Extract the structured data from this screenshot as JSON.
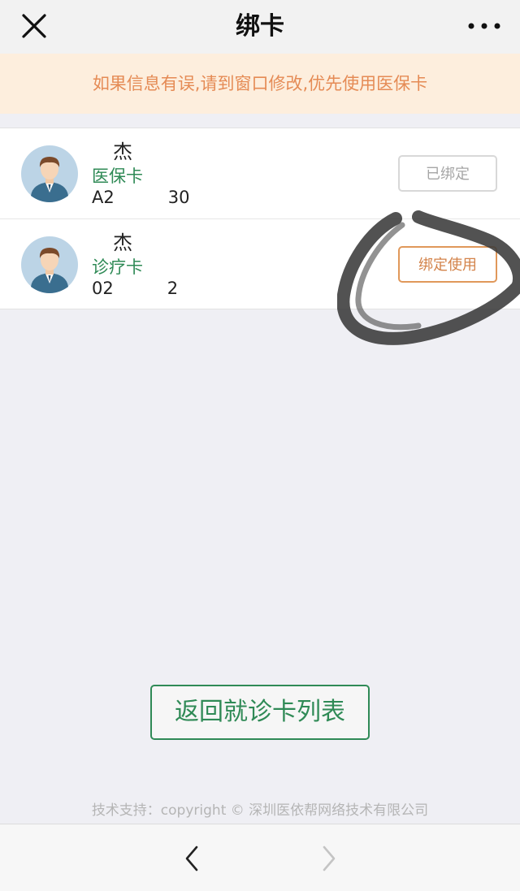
{
  "nav": {
    "title": "绑卡",
    "close_icon": "close-icon",
    "more_icon": "more-icon"
  },
  "notice": {
    "text": "如果信息有误,请到窗口修改,优先使用医保卡",
    "color": "#e58b55",
    "background": "#fdeedd"
  },
  "cards": [
    {
      "name": "杰",
      "type": "医保卡",
      "number_prefix": "A2",
      "number_suffix": "30",
      "button_label": "已绑定",
      "status": "bound"
    },
    {
      "name": "杰",
      "type": "诊疗卡",
      "number_prefix": "02",
      "number_suffix": "2",
      "button_label": "绑定使用",
      "status": "unbound"
    }
  ],
  "return_button": {
    "label": "返回就诊卡列表"
  },
  "footer": {
    "text": "技术支持：copyright © 深圳医依帮网络技术有限公司"
  },
  "bottom_bar": {
    "back_icon": "chevron-left-icon",
    "forward_icon": "chevron-right-icon"
  },
  "colors": {
    "accent_green": "#2f8a56",
    "accent_orange": "#d3834a",
    "background": "#efeff4"
  }
}
